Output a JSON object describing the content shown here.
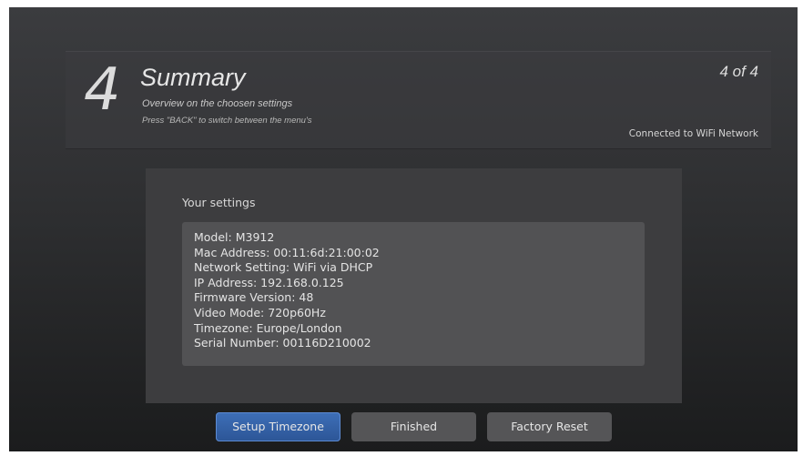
{
  "header": {
    "step_number": "4",
    "title": "Summary",
    "subtitle": "Overview on the choosen settings",
    "hint": "Press \"BACK\" to switch between the menu's",
    "page_indicator": "4 of 4",
    "connection_status": "Connected to WiFi Network"
  },
  "settings": {
    "heading": "Your settings",
    "items": [
      "Model: M3912",
      "Mac Address: 00:11:6d:21:00:02",
      "Network Setting: WiFi via DHCP",
      "IP Address: 192.168.0.125",
      "Firmware Version: 48",
      "Video Mode: 720p60Hz",
      "Timezone: Europe/London",
      "Serial Number: 00116D210002"
    ]
  },
  "buttons": {
    "setup_timezone": "Setup Timezone",
    "finished": "Finished",
    "factory_reset": "Factory Reset"
  },
  "colors": {
    "primary_button": "#2f5a9e",
    "secondary_button": "#555557",
    "panel": "#3d3d3f"
  }
}
